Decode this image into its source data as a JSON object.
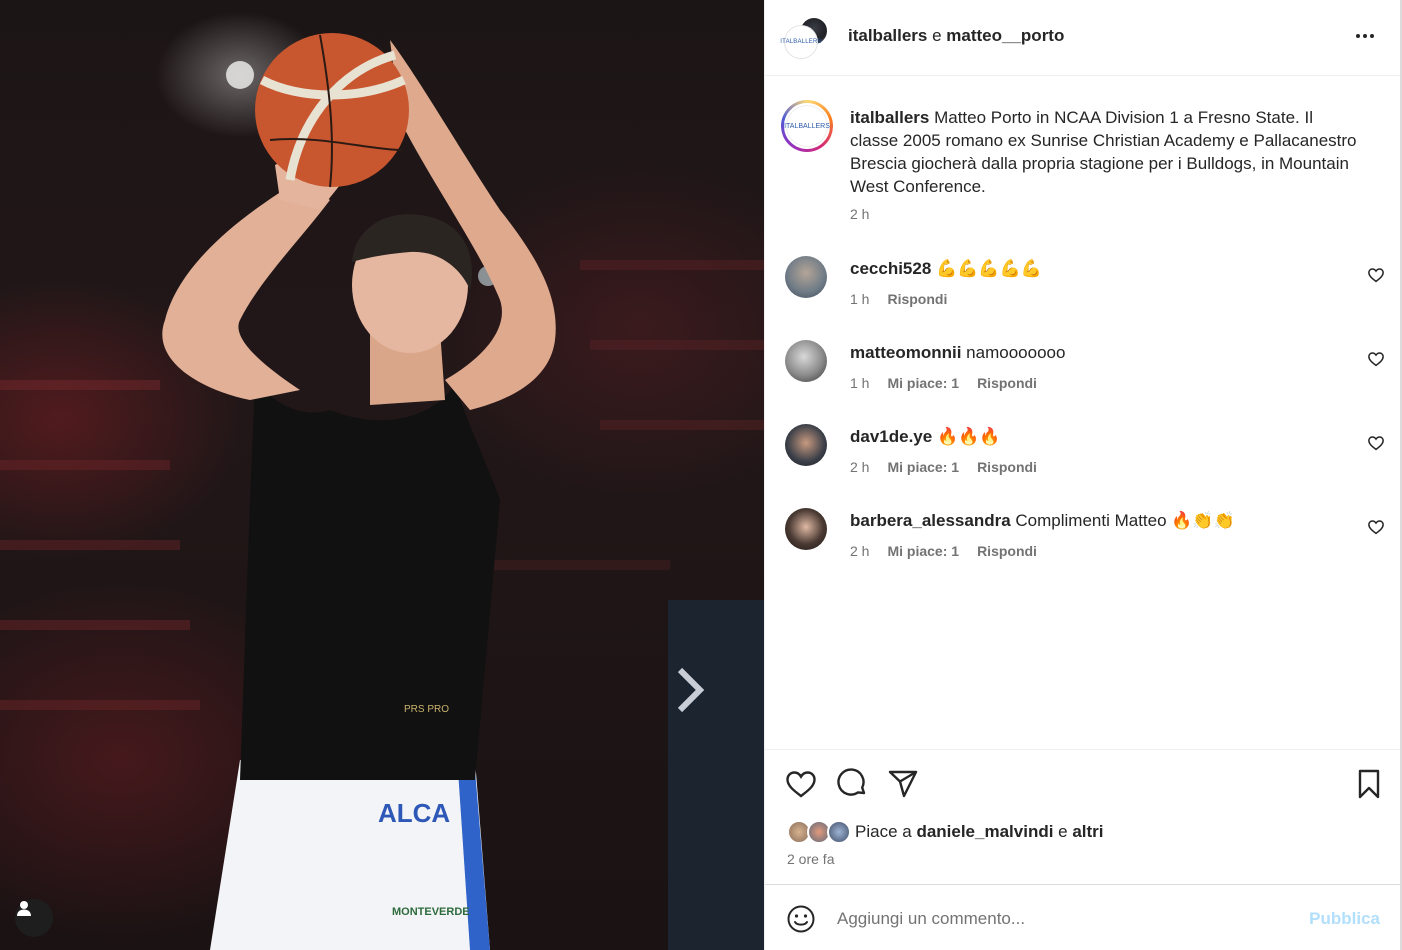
{
  "photo": {
    "jersey_print": "PRS PRO",
    "shorts_brand": "ALCA",
    "shorts_sponsor": "MONTEVERDE",
    "profile_icon": "person-icon"
  },
  "header": {
    "user1": "italballers",
    "joiner": " e ",
    "user2": "matteo__porto",
    "avatar_logo": "ITALBALLERS",
    "more_icon": "more-horizontal-icon"
  },
  "caption": {
    "username": "italballers",
    "text": " Matteo Porto in NCAA Division 1 a Fresno State. Il classe 2005 romano ex Sunrise Christian Academy e Pallacanestro Brescia giocherà dalla propria stagione per i Bulldogs, in Mountain West Conference.",
    "time": "2 h",
    "avatar_logo": "ITALBALLERS"
  },
  "comments": [
    {
      "username": "cecchi528",
      "text": " 💪💪💪💪💪",
      "time": "1 h",
      "likes": "",
      "reply": "Rispondi",
      "avatar_color": "#6d7a86"
    },
    {
      "username": "matteomonnii",
      "text": " namooooooo",
      "time": "1 h",
      "likes": "Mi piace: 1",
      "reply": "Rispondi",
      "avatar_color": "#8a8a8a"
    },
    {
      "username": "dav1de.ye",
      "text": " 🔥🔥🔥",
      "time": "2 h",
      "likes": "Mi piace: 1",
      "reply": "Rispondi",
      "avatar_color": "#3b3f48"
    },
    {
      "username": "barbera_alessandra",
      "text": " Complimenti Matteo 🔥👏👏",
      "time": "2 h",
      "likes": "Mi piace: 1",
      "reply": "Rispondi",
      "avatar_color": "#4a3a33"
    }
  ],
  "actions": {
    "like_icon": "heart-icon",
    "comment_icon": "comment-icon",
    "share_icon": "paper-plane-icon",
    "save_icon": "bookmark-icon",
    "likes_prefix": "Piace a ",
    "likes_user": "daniele_malvindi",
    "likes_mid": " e ",
    "likes_others": "altri",
    "time": "2 ore fa"
  },
  "comment_box": {
    "placeholder": "Aggiungi un commento...",
    "publish_label": "Pubblica",
    "emoji_icon": "smiley-icon"
  },
  "colors": {
    "accent_disabled": "#b2dffc",
    "muted_text": "#737373",
    "text": "#262626"
  }
}
